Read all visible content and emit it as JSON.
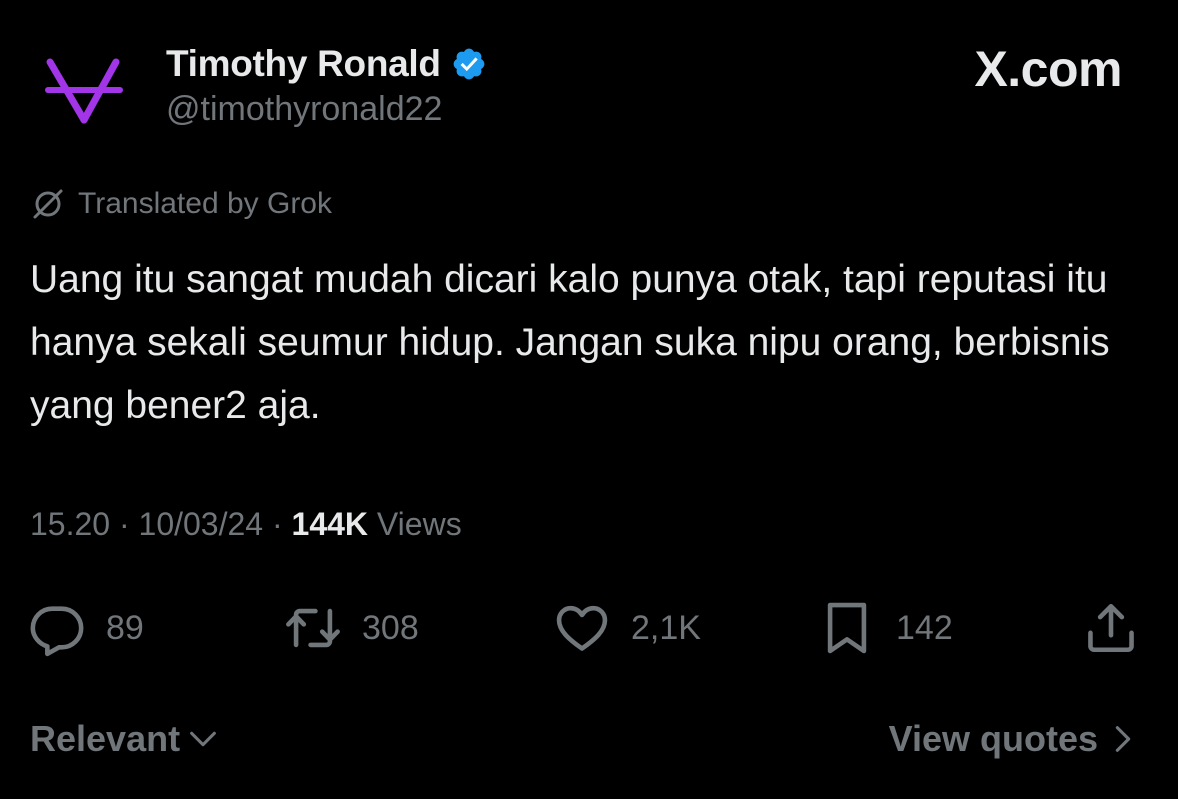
{
  "author": {
    "display_name": "Timothy Ronald",
    "handle": "@timothyronald22",
    "verified": true
  },
  "brand": "X.com",
  "translation_note": "Translated by Grok",
  "tweet": {
    "text": "Uang itu sangat mudah dicari kalo punya otak, tapi reputasi itu hanya sekali seumur hidup. Jangan suka nipu orang, berbisnis yang bener2 aja."
  },
  "meta": {
    "time": "15.20",
    "separator": "·",
    "date": "10/03/24",
    "views_count": "144K",
    "views_label": "Views"
  },
  "actions": {
    "replies": "89",
    "reposts": "308",
    "likes": "2,1K",
    "bookmarks": "142"
  },
  "footer": {
    "sort_label": "Relevant",
    "quotes_label": "View quotes"
  },
  "icons": {
    "avatar": "purple-v-logo",
    "verified": "verified-badge-icon",
    "translate": "grok-icon",
    "reply": "reply-icon",
    "repost": "repost-icon",
    "like": "heart-icon",
    "bookmark": "bookmark-icon",
    "share": "share-icon",
    "sort": "chevron-down-icon",
    "quotes": "chevron-right-icon"
  },
  "colors": {
    "background": "#000000",
    "primary_text": "#e7e9ea",
    "secondary_text": "#71767b",
    "verified_blue": "#1d9bf0",
    "avatar_purple": "#a335e8"
  }
}
